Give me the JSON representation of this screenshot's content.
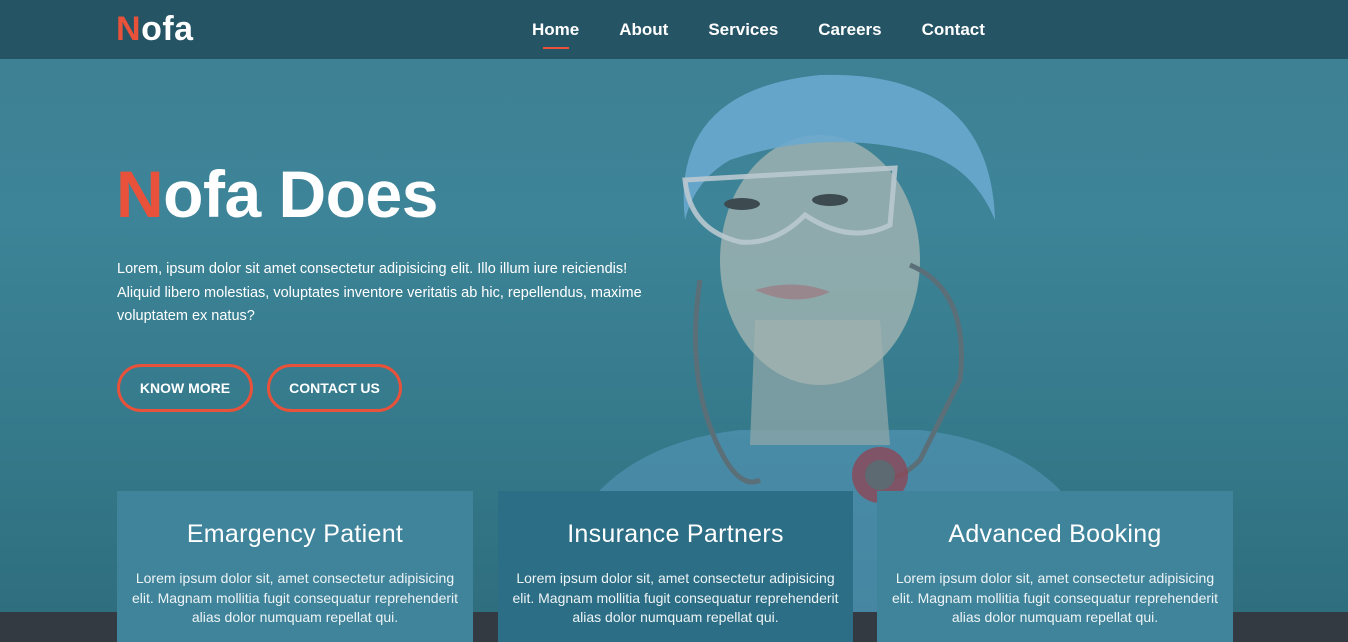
{
  "brand": {
    "logo_accent": "N",
    "logo_rest": "ofa",
    "accent_color": "#e8513a"
  },
  "nav": {
    "items": [
      {
        "label": "Home",
        "active": true
      },
      {
        "label": "About",
        "active": false
      },
      {
        "label": "Services",
        "active": false
      },
      {
        "label": "Careers",
        "active": false
      },
      {
        "label": "Contact",
        "active": false
      }
    ]
  },
  "hero": {
    "title_accent": "N",
    "title_rest": "ofa Does",
    "text": "Lorem, ipsum dolor sit amet consectetur adipisicing elit. Illo illum iure reiciendis! Aliquid libero molestias, voluptates inventore veritatis ab hic, repellendus, maxime voluptatem ex natus?",
    "buttons": {
      "know_more": "KNOW MORE",
      "contact_us": "CONTACT US"
    },
    "image_icon": "nurse-portrait-image"
  },
  "cards": [
    {
      "title": "Emargency Patient",
      "text": "Lorem ipsum dolor sit, amet consectetur adipisicing elit. Magnam mollitia fugit consequatur reprehenderit alias dolor numquam repellat qui."
    },
    {
      "title": "Insurance Partners",
      "text": "Lorem ipsum dolor sit, amet consectetur adipisicing elit. Magnam mollitia fugit consequatur reprehenderit alias dolor numquam repellat qui."
    },
    {
      "title": "Advanced Booking",
      "text": "Lorem ipsum dolor sit, amet consectetur adipisicing elit. Magnam mollitia fugit consequatur reprehenderit alias dolor numquam repellat qui."
    }
  ]
}
